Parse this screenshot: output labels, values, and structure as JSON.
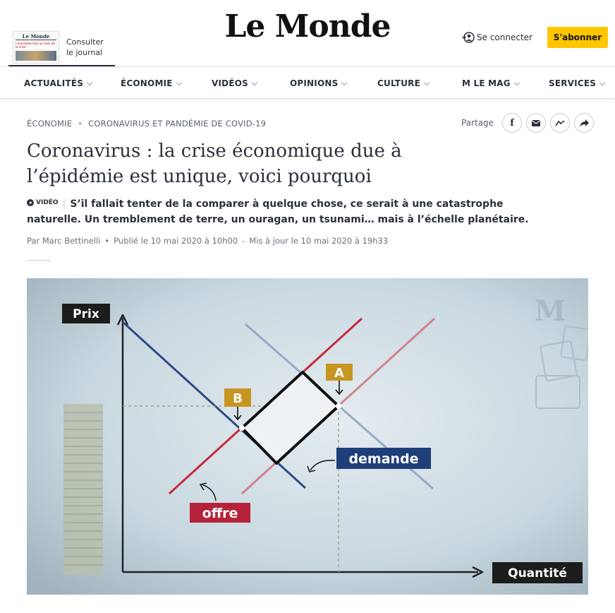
{
  "header": {
    "logo": "Le Monde",
    "journal_thumb_title": "Le Monde",
    "journal_thumb_headline": "L'économie face au choc de la crise",
    "consult_label_1": "Consulter",
    "consult_label_2": "le journal",
    "login_label": "Se connecter",
    "subscribe_label": "S'abonner"
  },
  "nav": {
    "items": [
      {
        "label": "ACTUALITÉS"
      },
      {
        "label": "ÉCONOMIE"
      },
      {
        "label": "VIDÉOS"
      },
      {
        "label": "OPINIONS"
      },
      {
        "label": "CULTURE"
      },
      {
        "label": "M LE MAG"
      },
      {
        "label": "SERVICES"
      }
    ]
  },
  "article": {
    "breadcrumb": [
      "ÉCONOMIE",
      "CORONAVIRUS ET PANDÉMIE DE COVID-19"
    ],
    "share_label": "Partage",
    "title": "Coronavirus : la crise économique due à l’épidémie est unique, voici pourquoi",
    "video_tag": "VIDÉO",
    "lede": "S’il fallait tenter de la comparer à quelque chose, ce serait à une catastrophe naturelle. Un tremblement de terre, un ouragan, un tsunami… mais à l’échelle planétaire.",
    "author": "Par Marc Bettinelli",
    "published": "Publié le 10 mai 2020 à 10h00",
    "updated": "Mis à jour le 10 mai 2020 à 19h33"
  },
  "figure": {
    "y_axis_label": "Prix",
    "x_axis_label": "Quantité",
    "label_supply": "offre",
    "label_demand": "demande",
    "point_a": "A",
    "point_b": "B",
    "watermark": "M",
    "colors": {
      "background": "#c9d8e0",
      "supply": "#c8283a",
      "demand": "#2e4a86",
      "marker": "#c79522",
      "demand_label_bg": "#1f3f7a",
      "supply_label_bg": "#b5223a"
    }
  }
}
